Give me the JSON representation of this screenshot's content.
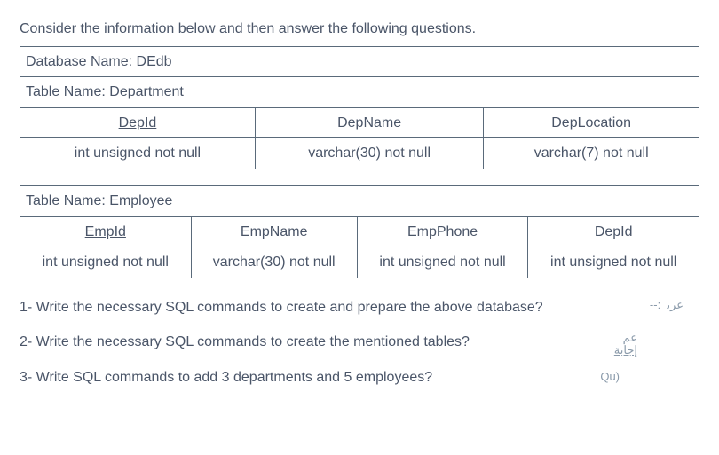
{
  "intro": "Consider the information below and then answer the following questions.",
  "db_row": "Database Name: DEdb",
  "table1": {
    "title": "Table Name: Department",
    "headers": [
      "DepId",
      "DepName",
      "DepLocation"
    ],
    "types": [
      "int unsigned not null",
      "varchar(30) not null",
      "varchar(7) not null"
    ]
  },
  "table2": {
    "title": "Table Name: Employee",
    "headers": [
      "EmpId",
      "EmpName",
      "EmpPhone",
      "DepId"
    ],
    "types": [
      "int unsigned not null",
      "varchar(30) not null",
      "int unsigned not null",
      "int unsigned not null"
    ]
  },
  "questions": {
    "q1": "1- Write the necessary SQL commands to create and prepare the above database?",
    "q2": "2- Write the necessary SQL commands to create the mentioned tables?",
    "q3": "3- Write SQL commands to add 3 departments and 5 employees?"
  },
  "annotations": {
    "a1a": "--:",
    "a1b": "ﻋﺮﺑ",
    "a2a": "ﻋﻢ",
    "a2b": "ﺇﺟﺎﺑﺔ",
    "a3": "Qu)"
  }
}
